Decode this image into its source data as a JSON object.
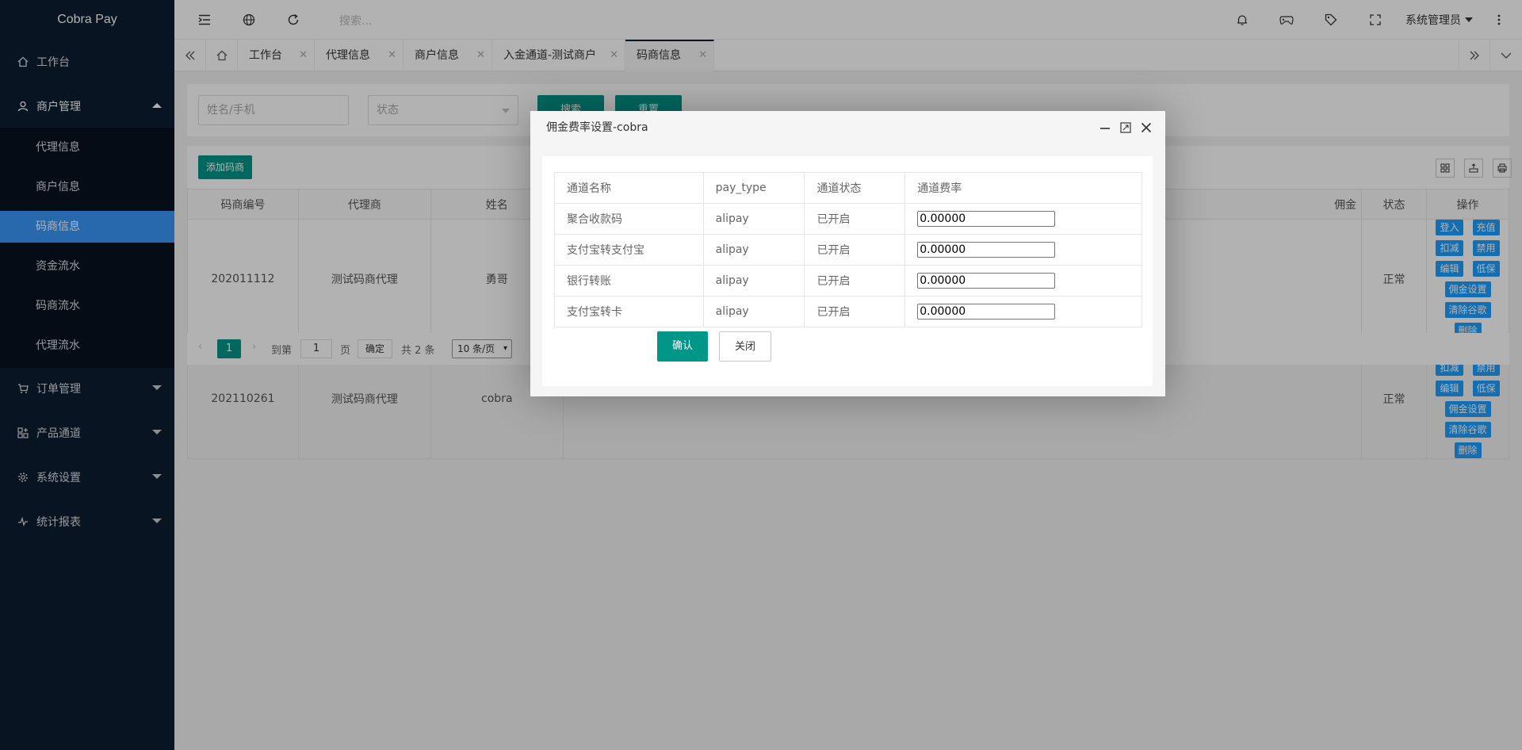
{
  "app": {
    "title": "Cobra Pay"
  },
  "sidebar": {
    "workbench": "工作台",
    "merchant_mgmt": "商户管理",
    "sub": [
      "代理信息",
      "商户信息",
      "码商信息",
      "资金流水",
      "码商流水",
      "代理流水"
    ],
    "order_mgmt": "订单管理",
    "product_channel": "产品通道",
    "system_settings": "系统设置",
    "stats_report": "统计报表"
  },
  "topbar": {
    "search_placeholder": "搜索...",
    "user": "系统管理员"
  },
  "tabs": [
    "工作台",
    "代理信息",
    "商户信息",
    "入金通道-测试商户",
    "码商信息"
  ],
  "filter": {
    "name_placeholder": "姓名/手机",
    "status_placeholder": "状态",
    "search_btn": "搜索",
    "reset_btn": "重置"
  },
  "toolbar": {
    "add_btn": "添加码商"
  },
  "table": {
    "headers": [
      "码商编号",
      "代理商",
      "姓名",
      "佣金",
      "状态",
      "操作"
    ],
    "rows": [
      {
        "id": "202011112",
        "agent": "测试码商代理",
        "name": "勇哥",
        "status": "正常"
      },
      {
        "id": "202110261",
        "agent": "测试码商代理",
        "name": "cobra",
        "status": "正常"
      }
    ],
    "ops": [
      "登入",
      "充值",
      "扣减",
      "禁用",
      "编辑",
      "低保",
      "佣金设置",
      "清除谷歌",
      "删除"
    ]
  },
  "pager": {
    "page": "1",
    "goto": "到第",
    "goto_value": "1",
    "page_unit": "页",
    "confirm": "确定",
    "total": "共 2 条",
    "per_page": "10 条/页"
  },
  "modal": {
    "title": "佣金费率设置-cobra",
    "headers": [
      "通道名称",
      "pay_type",
      "通道状态",
      "通道费率"
    ],
    "rows": [
      {
        "name": "聚合收款码",
        "pay_type": "alipay",
        "status": "已开启",
        "rate": "0.00000"
      },
      {
        "name": "支付宝转支付宝",
        "pay_type": "alipay",
        "status": "已开启",
        "rate": "0.00000"
      },
      {
        "name": "银行转账",
        "pay_type": "alipay",
        "status": "已开启",
        "rate": "0.00000"
      },
      {
        "name": "支付宝转卡",
        "pay_type": "alipay",
        "status": "已开启",
        "rate": "0.00000"
      }
    ],
    "confirm_btn": "确认",
    "close_btn": "关闭"
  },
  "colors": {
    "sidebar": "#0c1d31",
    "active": "#3a95f8",
    "primary": "#009688",
    "op_btn": "#1e9fff"
  }
}
